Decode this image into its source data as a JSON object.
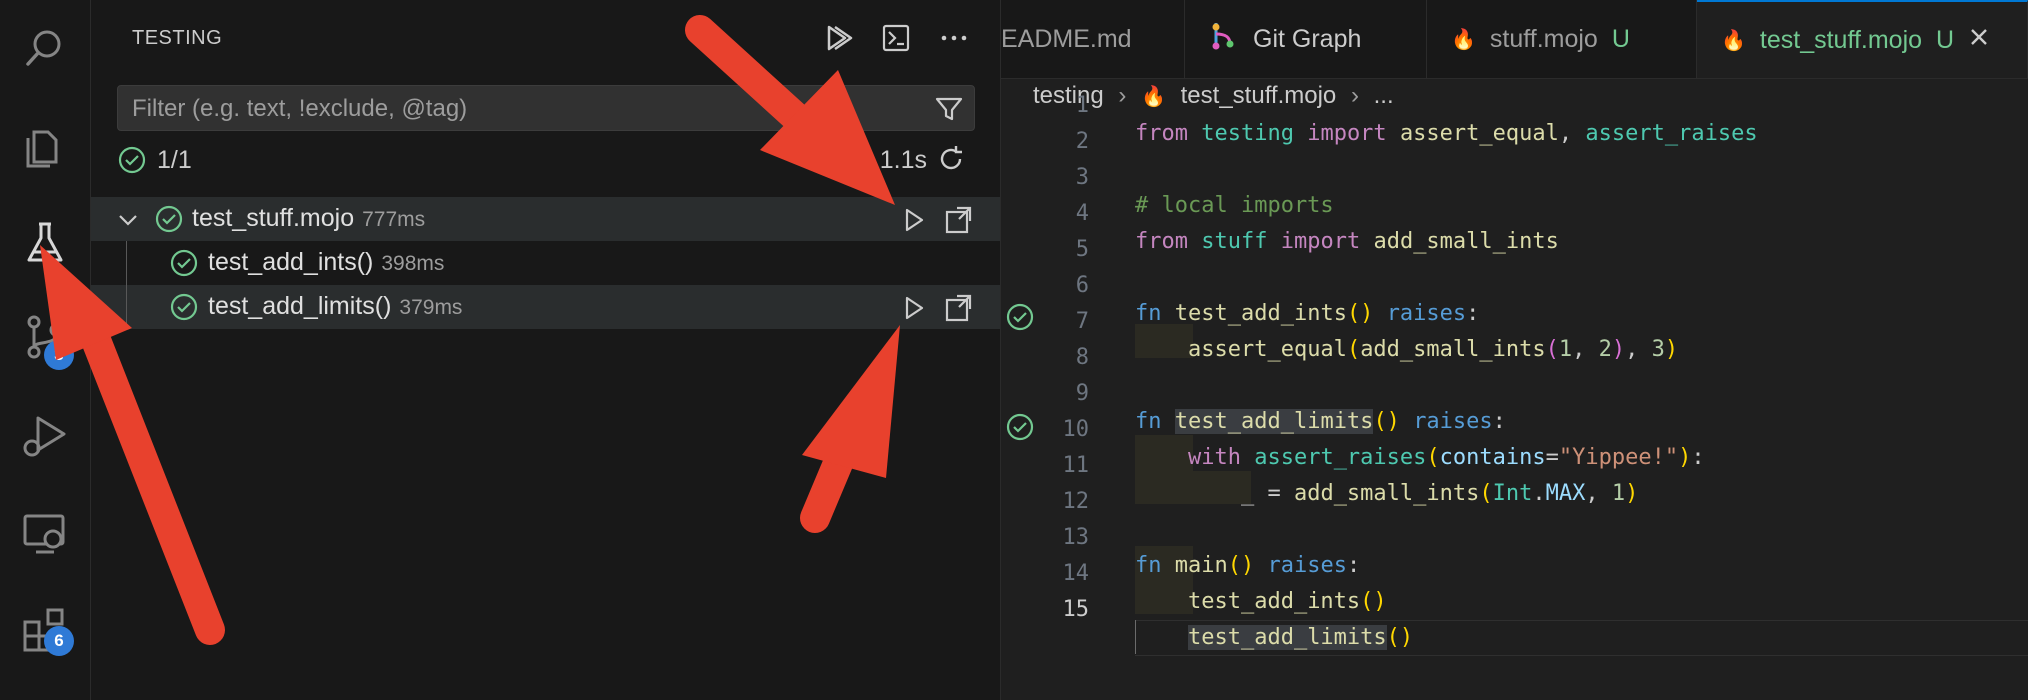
{
  "activity_bar": {
    "scm_badge": "3",
    "extensions_badge": "6"
  },
  "testing": {
    "title": "TESTING",
    "filter_placeholder": "Filter (e.g. text, !exclude, @tag)",
    "summary_count": "1/1",
    "summary_duration": "1.1s",
    "items": [
      {
        "name": "test_stuff.mojo",
        "time": "777ms"
      },
      {
        "name": "test_add_ints()",
        "time": "398ms"
      },
      {
        "name": "test_add_limits()",
        "time": "379ms"
      }
    ]
  },
  "tabs": [
    {
      "label": "EADME.md"
    },
    {
      "label": "Git Graph"
    },
    {
      "label": "stuff.mojo",
      "status": "U"
    },
    {
      "label": "test_stuff.mojo",
      "status": "U"
    }
  ],
  "breadcrumb": {
    "folder": "testing",
    "file": "test_stuff.mojo",
    "more": "..."
  },
  "line_numbers": [
    "1",
    "2",
    "3",
    "4",
    "5",
    "6",
    "7",
    "8",
    "9",
    "10",
    "11",
    "12",
    "13",
    "14",
    "15"
  ],
  "colors": {
    "accent": "#0078d4",
    "pass": "#73c991",
    "arrow": "#e8412d"
  }
}
